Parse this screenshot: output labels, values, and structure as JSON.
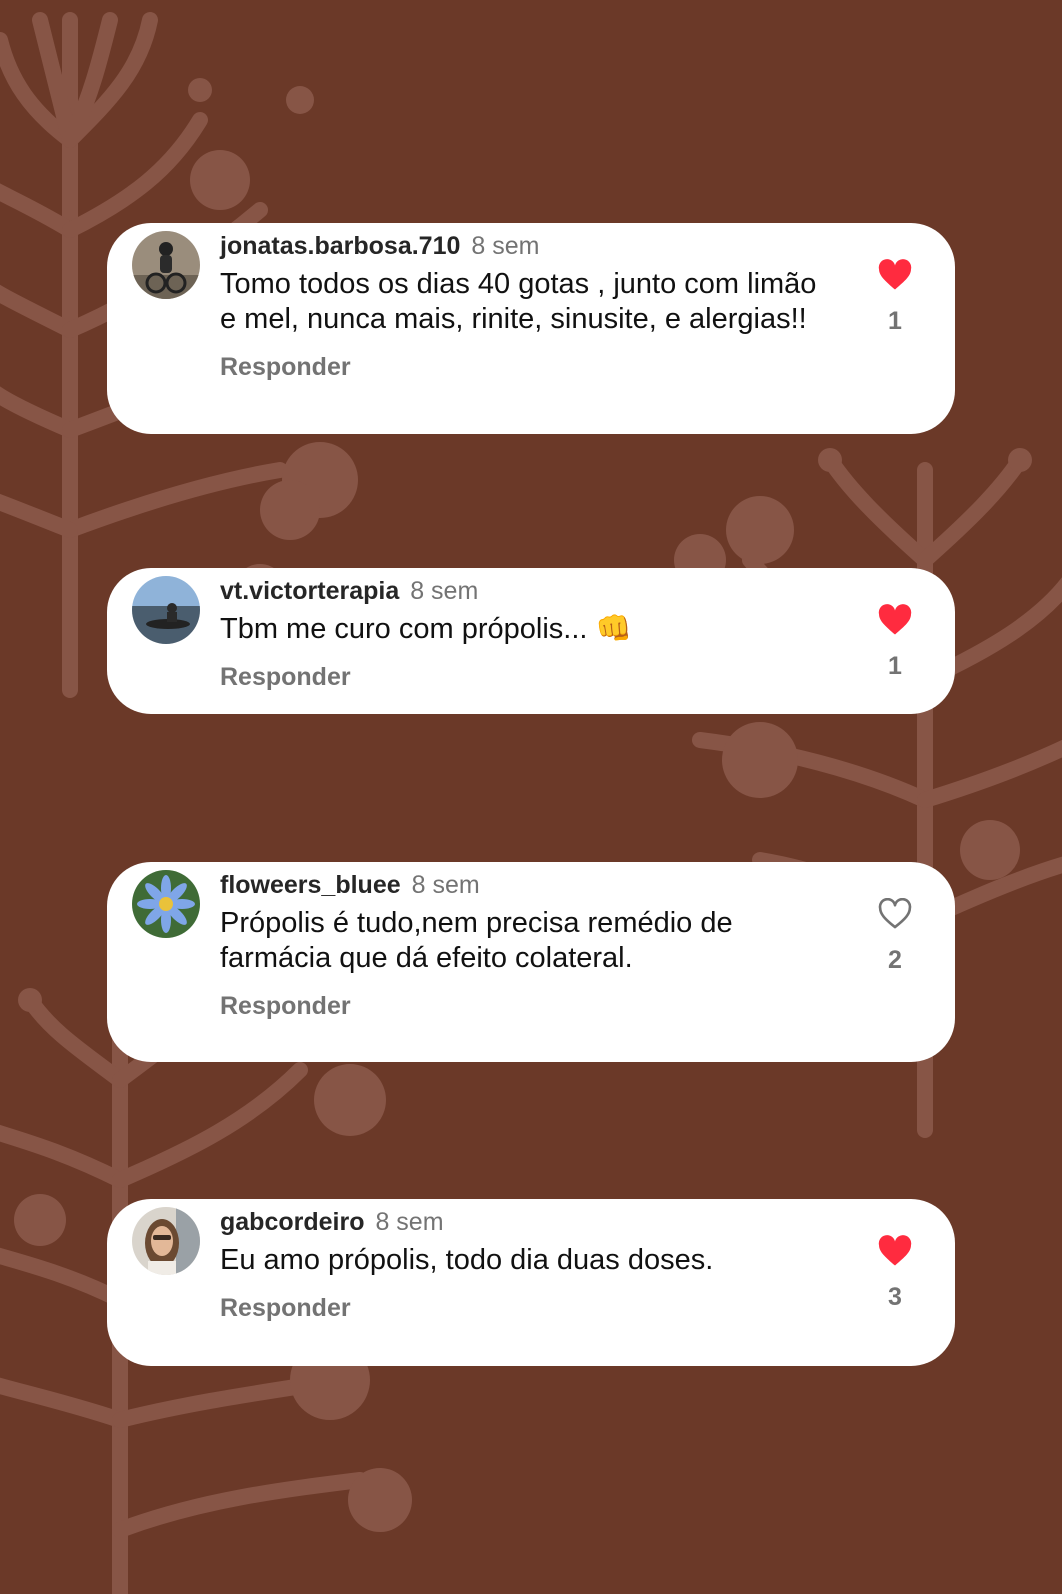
{
  "colors": {
    "background": "#6b3928",
    "decor": "#875546",
    "liked_heart": "#ff2b3f",
    "unliked_heart": "#737373"
  },
  "comments": [
    {
      "username": "jonatas.barbosa.710",
      "time": "8 sem",
      "text": "Tomo todos os dias 40 gotas , junto com limão e mel,  nunca mais,  rinite, sinusite,  e alergias!!",
      "reply_label": "Responder",
      "liked": true,
      "like_count": "1",
      "heart_icon": "heart-filled-icon",
      "avatar": "person-cycling-avatar"
    },
    {
      "username": "vt.victorterapia",
      "time": "8 sem",
      "text": "Tbm me curo com própolis... 👊",
      "reply_label": "Responder",
      "liked": true,
      "like_count": "1",
      "heart_icon": "heart-filled-icon",
      "avatar": "person-kayak-avatar"
    },
    {
      "username": "floweers_bluee",
      "time": "8 sem",
      "text": "Própolis é tudo,nem precisa remédio de farmácia que dá efeito colateral.",
      "reply_label": "Responder",
      "liked": false,
      "like_count": "2",
      "heart_icon": "heart-outline-icon",
      "avatar": "blue-flower-avatar"
    },
    {
      "username": "gabcordeiro",
      "time": "8 sem",
      "text": "Eu amo própolis, todo dia duas doses.",
      "reply_label": "Responder",
      "liked": true,
      "like_count": "3",
      "heart_icon": "heart-filled-icon",
      "avatar": "woman-selfie-avatar"
    }
  ]
}
